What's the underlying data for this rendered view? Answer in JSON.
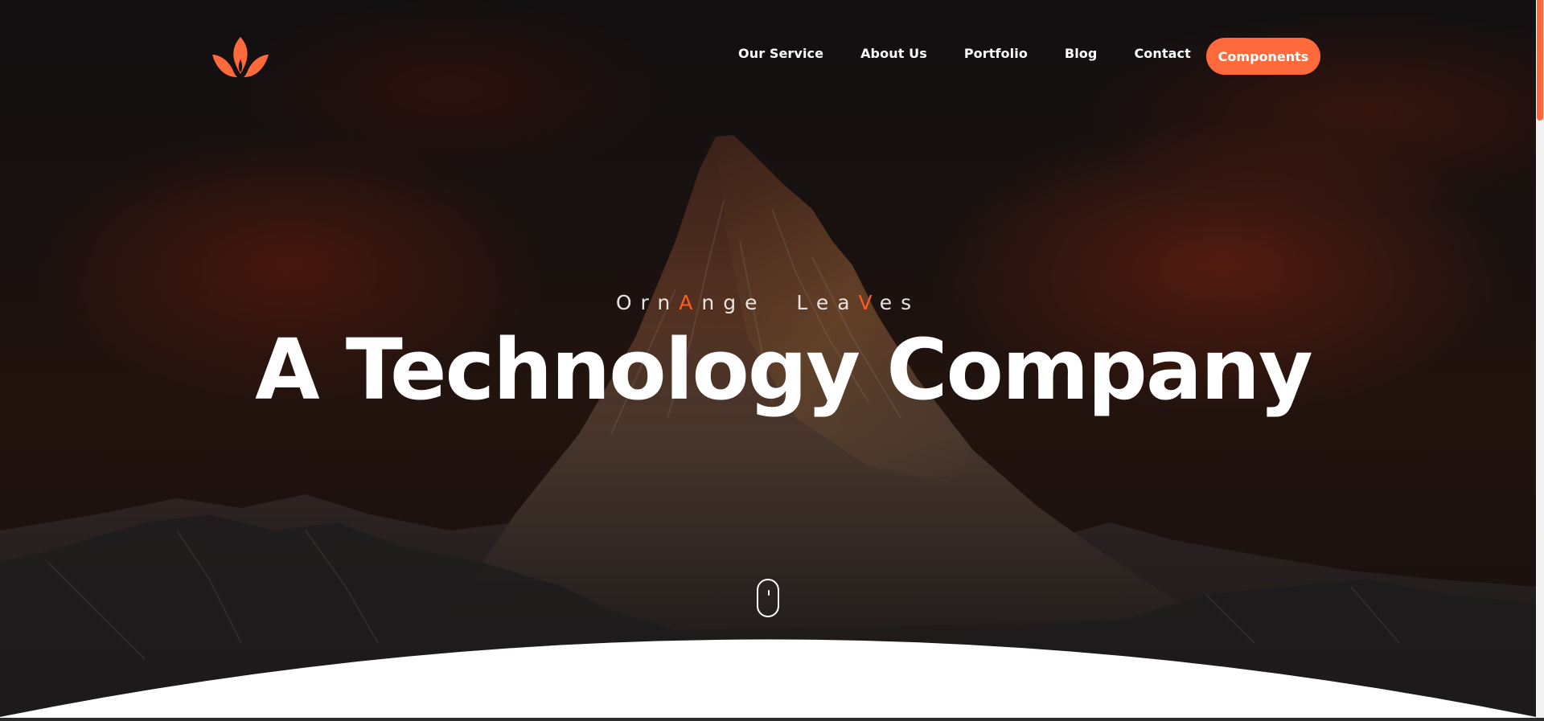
{
  "nav": {
    "logo_icon": "lotus-icon",
    "items": [
      {
        "label": "Our Service"
      },
      {
        "label": "About Us"
      },
      {
        "label": "Portfolio"
      },
      {
        "label": "Blog"
      },
      {
        "label": "Contact"
      }
    ],
    "cta_label": "Components"
  },
  "hero": {
    "tagline_parts": [
      "Orn",
      "A",
      "nge  Lea",
      "V",
      "es"
    ],
    "headline": "A Technology Company",
    "scroll_icon": "mouse-scroll-icon"
  },
  "colors": {
    "accent": "#ff6a3d",
    "tagline_accent": "#ff5a26",
    "text": "#ffffff"
  },
  "scrollbar": {
    "thumb_color": "#ff6a3d"
  }
}
